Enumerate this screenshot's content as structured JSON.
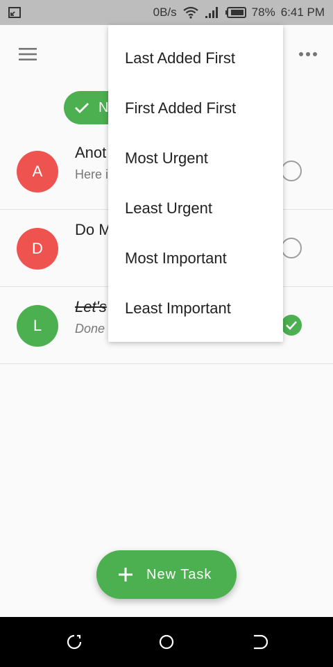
{
  "status_bar": {
    "net_speed": "0B/s",
    "battery_pct": "78%",
    "time": "6:41 PM"
  },
  "chip": {
    "label": "N"
  },
  "tasks": [
    {
      "avatar_letter": "A",
      "avatar_color": "#ef5350",
      "title": "Anot",
      "subtitle": "Here i",
      "completed": false
    },
    {
      "avatar_letter": "D",
      "avatar_color": "#ef5350",
      "title": "Do M",
      "subtitle": "",
      "completed": false
    },
    {
      "avatar_letter": "L",
      "avatar_color": "#4caf50",
      "title": "Let's",
      "subtitle": "Done",
      "completed": true
    }
  ],
  "sort_menu": {
    "items": [
      "Last Added First",
      "First Added First",
      "Most Urgent",
      "Least Urgent",
      "Most Important",
      "Least Important"
    ]
  },
  "fab": {
    "label": "New Task"
  },
  "colors": {
    "accent": "#4caf50",
    "urgent": "#ef5350"
  }
}
